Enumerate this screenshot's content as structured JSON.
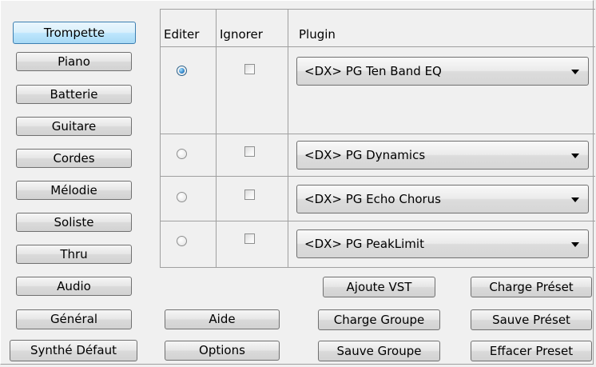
{
  "instruments": [
    {
      "label": "Trompette",
      "active": true
    },
    {
      "label": "Piano",
      "active": false
    },
    {
      "label": "Batterie",
      "active": false
    },
    {
      "label": "Guitare",
      "active": false
    },
    {
      "label": "Cordes",
      "active": false
    },
    {
      "label": "Mélodie",
      "active": false
    },
    {
      "label": "Soliste",
      "active": false
    },
    {
      "label": "Thru",
      "active": false
    },
    {
      "label": "Audio",
      "active": false
    },
    {
      "label": "Général",
      "active": false
    },
    {
      "label": "Synthé Défaut",
      "active": false
    }
  ],
  "table": {
    "headers": {
      "edit": "Editer",
      "ignore": "Ignorer",
      "plugin": "Plugin"
    },
    "rows": [
      {
        "edit_selected": true,
        "ignore_checked": false,
        "plugin": "<DX> PG Ten Band EQ"
      },
      {
        "edit_selected": false,
        "ignore_checked": false,
        "plugin": "<DX> PG Dynamics"
      },
      {
        "edit_selected": false,
        "ignore_checked": false,
        "plugin": "<DX> PG Echo Chorus"
      },
      {
        "edit_selected": false,
        "ignore_checked": false,
        "plugin": "<DX> PG PeakLimit"
      }
    ]
  },
  "buttons": {
    "aide": "Aide",
    "options": "Options",
    "ajoute_vst": "Ajoute VST",
    "charge_groupe": "Charge Groupe",
    "sauve_groupe": "Sauve Groupe",
    "charge_preset": "Charge Préset",
    "sauve_preset": "Sauve Préset",
    "effacer_preset": "Effacer Preset"
  }
}
